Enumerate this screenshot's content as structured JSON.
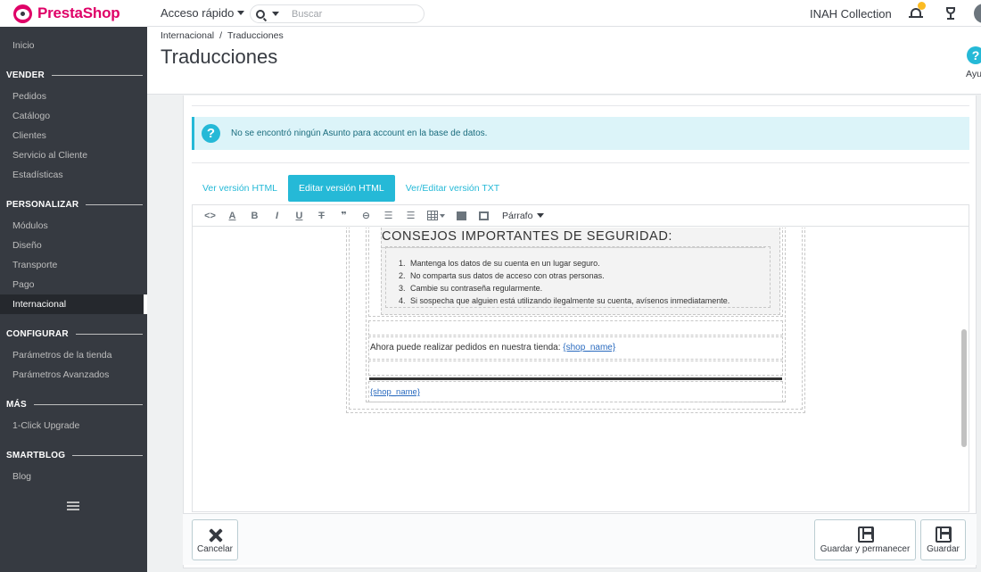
{
  "header": {
    "brand": "PrestaShop",
    "quick_access": "Acceso rápido",
    "search_placeholder": "Buscar",
    "shop_name": "INAH Collection"
  },
  "sidebar": {
    "items": [
      {
        "label": "Inicio"
      },
      {
        "section": "VENDER"
      },
      {
        "label": "Pedidos"
      },
      {
        "label": "Catálogo"
      },
      {
        "label": "Clientes"
      },
      {
        "label": "Servicio al Cliente"
      },
      {
        "label": "Estadísticas"
      },
      {
        "section": "PERSONALIZAR"
      },
      {
        "label": "Módulos"
      },
      {
        "label": "Diseño"
      },
      {
        "label": "Transporte"
      },
      {
        "label": "Pago"
      },
      {
        "label": "Internacional",
        "active": true
      },
      {
        "section": "CONFIGURAR"
      },
      {
        "label": "Parámetros de la tienda"
      },
      {
        "label": "Parámetros Avanzados"
      },
      {
        "section": "MÁS"
      },
      {
        "label": "1-Click Upgrade"
      },
      {
        "section": "SMARTBLOG"
      },
      {
        "label": "Blog"
      }
    ]
  },
  "page": {
    "breadcrumb": [
      "Internacional",
      "Traducciones"
    ],
    "breadcrumb_sep": "/",
    "title": "Traducciones",
    "help_label": "Ayu"
  },
  "alert": {
    "message": "No se encontró ningún Asunto para account en la base de datos."
  },
  "tabs": [
    {
      "label": "Ver versión HTML",
      "active": false
    },
    {
      "label": "Editar versión HTML",
      "active": true
    },
    {
      "label": "Ver/Editar versión TXT",
      "active": false
    }
  ],
  "toolbar": {
    "paragraph_format": "Párrafo",
    "buttons": [
      "code-icon",
      "text-color-icon",
      "bold-icon",
      "italic-icon",
      "underline-icon",
      "strikethrough-icon",
      "quote-icon",
      "link-icon",
      "bullet-list-icon",
      "numbered-list-icon",
      "table-icon",
      "image-icon",
      "media-icon"
    ]
  },
  "email": {
    "section_title": "CONSEJOS IMPORTANTES DE SEGURIDAD:",
    "tips": [
      "Mantenga los datos de su cuenta en un lugar seguro.",
      "No comparta sus datos de acceso con otras personas.",
      "Cambie su contraseña regularmente.",
      "Si sospecha que alguien está utilizando ilegalmente su cuenta, avísenos inmediatamente."
    ],
    "orders_text": "Ahora puede realizar pedidos en nuestra tienda:",
    "shop_name_var": "{shop_name}",
    "footer_shop_name": "{shop_name}"
  },
  "actions": {
    "cancel": "Cancelar",
    "save_stay": "Guardar y permanecer",
    "save": "Guardar"
  }
}
